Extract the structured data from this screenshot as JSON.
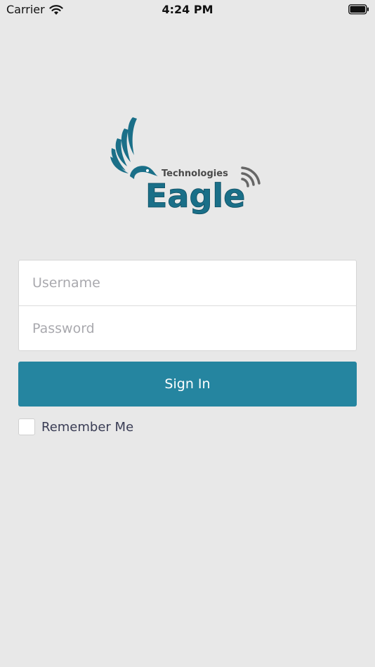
{
  "status_bar": {
    "carrier": "Carrier",
    "time": "4:24 PM",
    "icons": [
      "wifi-icon",
      "battery-icon"
    ]
  },
  "logo": {
    "top_text": "Technologies",
    "main_text": "Eagle",
    "colors": {
      "primary": "#1a6f88",
      "secondary": "#4a4a4a",
      "signal": "#666666"
    }
  },
  "login_form": {
    "username_placeholder": "Username",
    "password_placeholder": "Password",
    "signin_label": "Sign In",
    "remember_label": "Remember Me",
    "remember_checked": false
  },
  "colors": {
    "background": "#e8e8e8",
    "accent": "#2585a0"
  }
}
